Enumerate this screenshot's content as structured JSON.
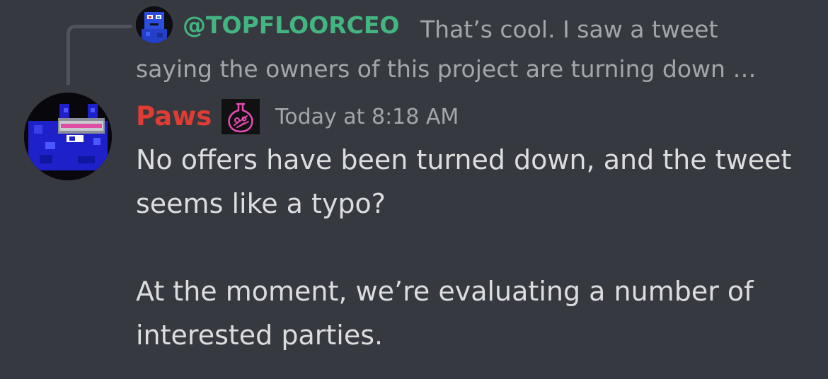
{
  "reply": {
    "author": "@TOPFLOORCEO",
    "preview": "That’s cool. I saw a tweet saying the owners of this project are turning down …",
    "avatar_icon": "pixel-character-avatar"
  },
  "message": {
    "author": "Paws",
    "author_color": "#e03c33",
    "role_icon": "flask-icon",
    "timestamp": "Today at 8:18 AM",
    "paragraphs": [
      "No offers have been turned down, and the tweet seems like a typo?",
      "At the moment, we’re evaluating a number of interested parties."
    ],
    "avatar_icon": "pixel-cat-avatar"
  },
  "colors": {
    "background": "#36393f",
    "reply_author": "#43b581",
    "muted_text": "#a3a6aa",
    "body_text": "#dcddde",
    "role_icon": "#e84bb5"
  }
}
